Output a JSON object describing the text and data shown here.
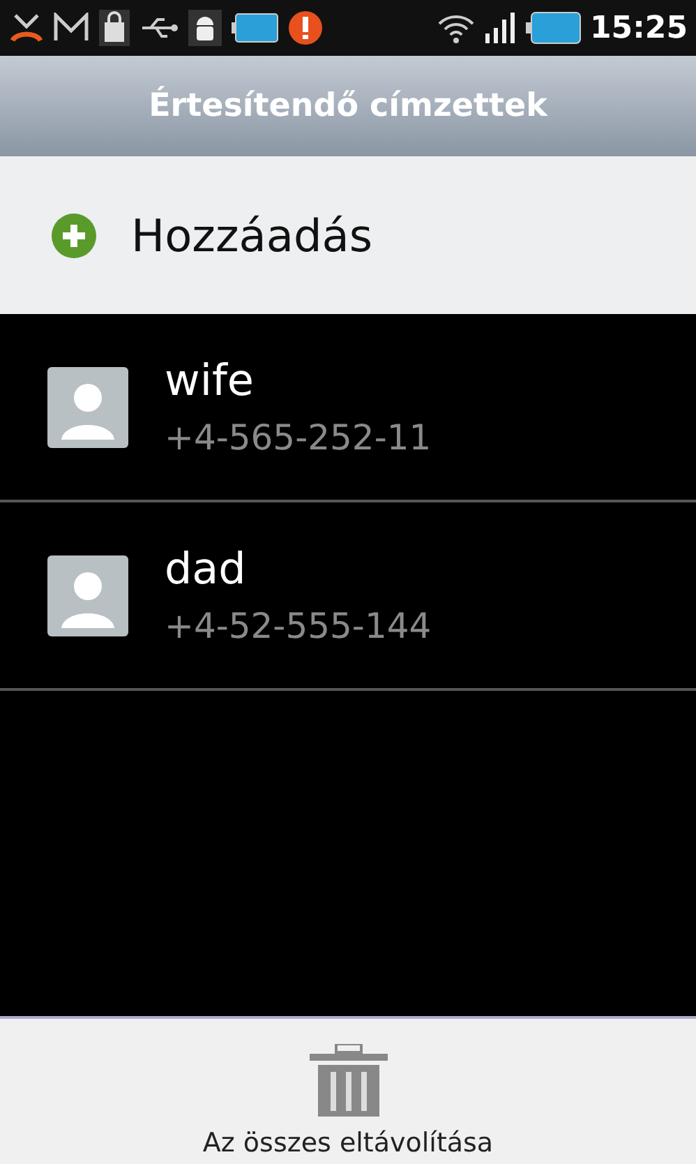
{
  "status_bar": {
    "time": "15:25"
  },
  "title": "Értesítendő címzettek",
  "add_button": {
    "label": "Hozzáadás"
  },
  "contacts": [
    {
      "name": "wife",
      "phone": "+4-565-252-11"
    },
    {
      "name": "dad",
      "phone": "+4-52-555-144"
    }
  ],
  "bottom_action": {
    "label": "Az összes eltávolítása"
  }
}
